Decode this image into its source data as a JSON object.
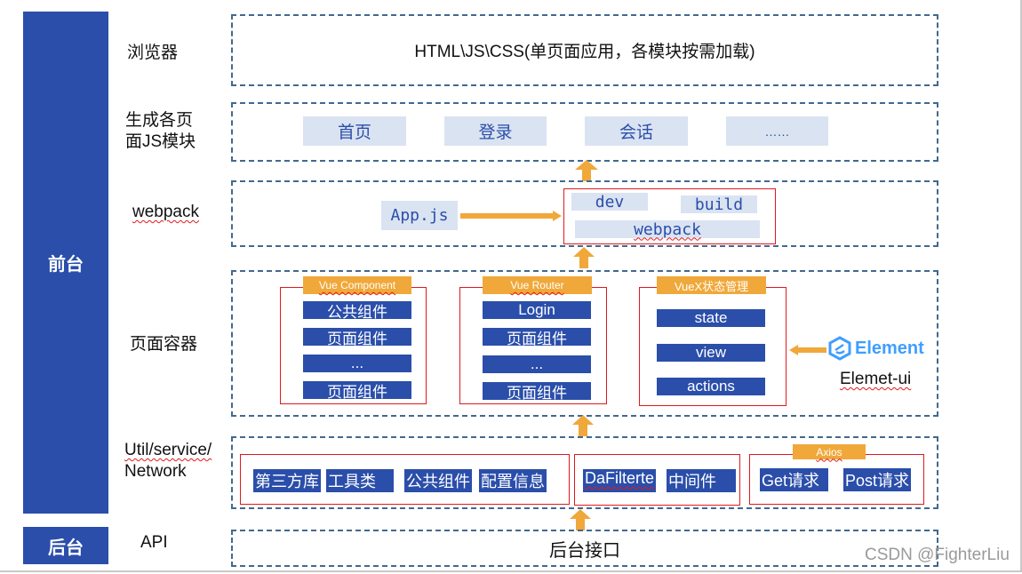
{
  "sidebar": {
    "frontend_label": "前台",
    "backend_label": "后台"
  },
  "layers": {
    "browser": {
      "label": "浏览器",
      "content": "HTML\\JS\\CSS(单页面应用，各模块按需加载)"
    },
    "pages": {
      "label_line1": "生成各页",
      "label_line2": "面JS模块",
      "items": [
        "首页",
        "登录",
        "会话",
        "……"
      ]
    },
    "webpack": {
      "label": "webpack",
      "entry": "App.js",
      "modes": [
        "dev",
        "build"
      ],
      "tool": "webpack"
    },
    "container": {
      "label": "页面容器",
      "groups": [
        {
          "title": "Vue Component",
          "items": [
            "公共组件",
            "页面组件",
            "...",
            "页面组件"
          ]
        },
        {
          "title": "Vue Router",
          "items": [
            "Login",
            "页面组件",
            "...",
            "页面组件"
          ]
        },
        {
          "title": "VueX状态管理",
          "items": [
            "state",
            "view",
            "actions"
          ]
        }
      ],
      "element_logo_text": "Element",
      "element_caption": "Elemet-ui"
    },
    "util": {
      "label_line1": "Util/service/",
      "label_line2": "Network",
      "group1": [
        "第三方库",
        "工具类",
        "公共组件",
        "配置信息"
      ],
      "group2": [
        "DaFilterte",
        "中间件"
      ],
      "axios": {
        "title": "Axios",
        "items": [
          "Get请求",
          "Post请求"
        ]
      }
    },
    "api": {
      "label": "API",
      "content": "后台接口"
    }
  },
  "colors": {
    "primary_blue": "#2a4eaa",
    "light_blue": "#dae3f1",
    "orange": "#f0a83a",
    "red": "#e0191e",
    "dash": "#41698f"
  },
  "watermark": "CSDN @FighterLiu"
}
